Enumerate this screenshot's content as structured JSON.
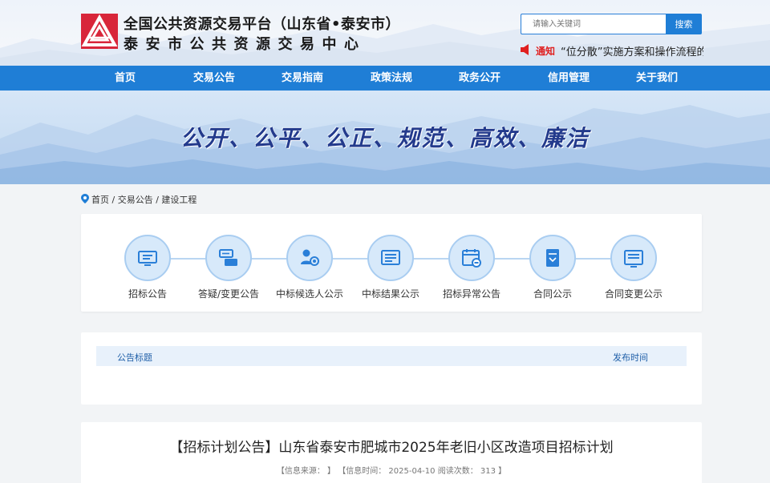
{
  "header": {
    "title_line1": "全国公共资源交易平台（山东省•泰安市）",
    "title_line2": "泰安市公共资源交易中心",
    "search_placeholder": "请输入关键词",
    "search_button": "搜索",
    "notice_tag": "通知",
    "notice_text": "“位分散”实施方案和操作流程的"
  },
  "nav": {
    "items": [
      "首页",
      "交易公告",
      "交易指南",
      "政策法规",
      "政务公开",
      "信用管理",
      "关于我们"
    ]
  },
  "banner": {
    "slogan": "公开、公平、公正、规范、高效、廉洁"
  },
  "breadcrumb": {
    "text": "首页 / 交易公告 / 建设工程"
  },
  "categories": [
    {
      "label": "招标公告",
      "icon": "monitor-icon"
    },
    {
      "label": "答疑/变更公告",
      "icon": "exchange-icon"
    },
    {
      "label": "中标候选人公示",
      "icon": "person-badge-icon"
    },
    {
      "label": "中标结果公示",
      "icon": "list-screen-icon"
    },
    {
      "label": "招标异常公告",
      "icon": "calendar-minus-icon"
    },
    {
      "label": "合同公示",
      "icon": "contract-icon"
    },
    {
      "label": "合同变更公示",
      "icon": "document-screen-icon"
    }
  ],
  "list": {
    "col_title": "公告标题",
    "col_time": "发布时间"
  },
  "article": {
    "title": "【招标计划公告】山东省泰安市肥城市2025年老旧小区改造项目招标计划",
    "meta": "【信息来源： 】 【信息时间： 2025-04-10  阅读次数： 313 】"
  },
  "colors": {
    "primary": "#1f7ed6",
    "notice_red": "#e02020",
    "slogan": "#233a8c"
  }
}
